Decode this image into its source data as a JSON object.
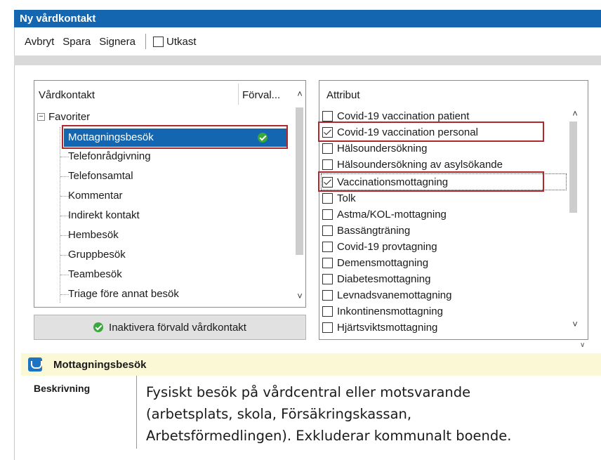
{
  "window": {
    "title": "Ny vårdkontakt"
  },
  "toolbar": {
    "cancel_label": "Avbryt",
    "save_label": "Spara",
    "sign_label": "Signera",
    "draft_label": "Utkast",
    "draft_checked": false
  },
  "contact_panel": {
    "col_contact": "Vårdkontakt",
    "col_default": "Förval...",
    "group": "Favoriter",
    "items": [
      "Mottagningsbesök",
      "Telefonrådgivning",
      "Telefonsamtal",
      "Kommentar",
      "Indirekt kontakt",
      "Hembesök",
      "Gruppbesök",
      "Teambesök",
      "Triage före annat besök"
    ],
    "selected_index": 0
  },
  "inactivate_button": {
    "label": "Inaktivera förvald vårdkontakt"
  },
  "attributes_panel": {
    "header": "Attribut",
    "items": [
      {
        "label": "Covid-19 vaccination patient",
        "checked": false
      },
      {
        "label": "Covid-19 vaccination personal",
        "checked": true
      },
      {
        "label": "Hälsoundersökning",
        "checked": false
      },
      {
        "label": "Hälsoundersökning av asylsökande",
        "checked": false
      },
      {
        "label": "Vaccinationsmottagning",
        "checked": true
      },
      {
        "label": "Tolk",
        "checked": false
      },
      {
        "label": "Astma/KOL-mottagning",
        "checked": false
      },
      {
        "label": "Bassängträning",
        "checked": false
      },
      {
        "label": "Covid-19 provtagning",
        "checked": false
      },
      {
        "label": "Demensmottagning",
        "checked": false
      },
      {
        "label": "Diabetesmottagning",
        "checked": false
      },
      {
        "label": "Levnadsvanemottagning",
        "checked": false
      },
      {
        "label": "Inkontinensmottagning",
        "checked": false
      },
      {
        "label": "Hjärtsviktsmottagning",
        "checked": false
      }
    ]
  },
  "info": {
    "title": "Mottagningsbesök",
    "description_label": "Beskrivning",
    "description_lines": [
      "Fysiskt besök på vårdcentral eller motsvarande",
      "(arbetsplats, skola, Försäkringskassan,",
      "Arbetsförmedlingen). Exkluderar kommunalt boende."
    ]
  },
  "colors": {
    "titlebar": "#1466b0",
    "selection": "#1466b0",
    "highlight_border": "#b0282d",
    "default_check": "#3aa83a",
    "info_header_bg": "#fbf8d6"
  }
}
